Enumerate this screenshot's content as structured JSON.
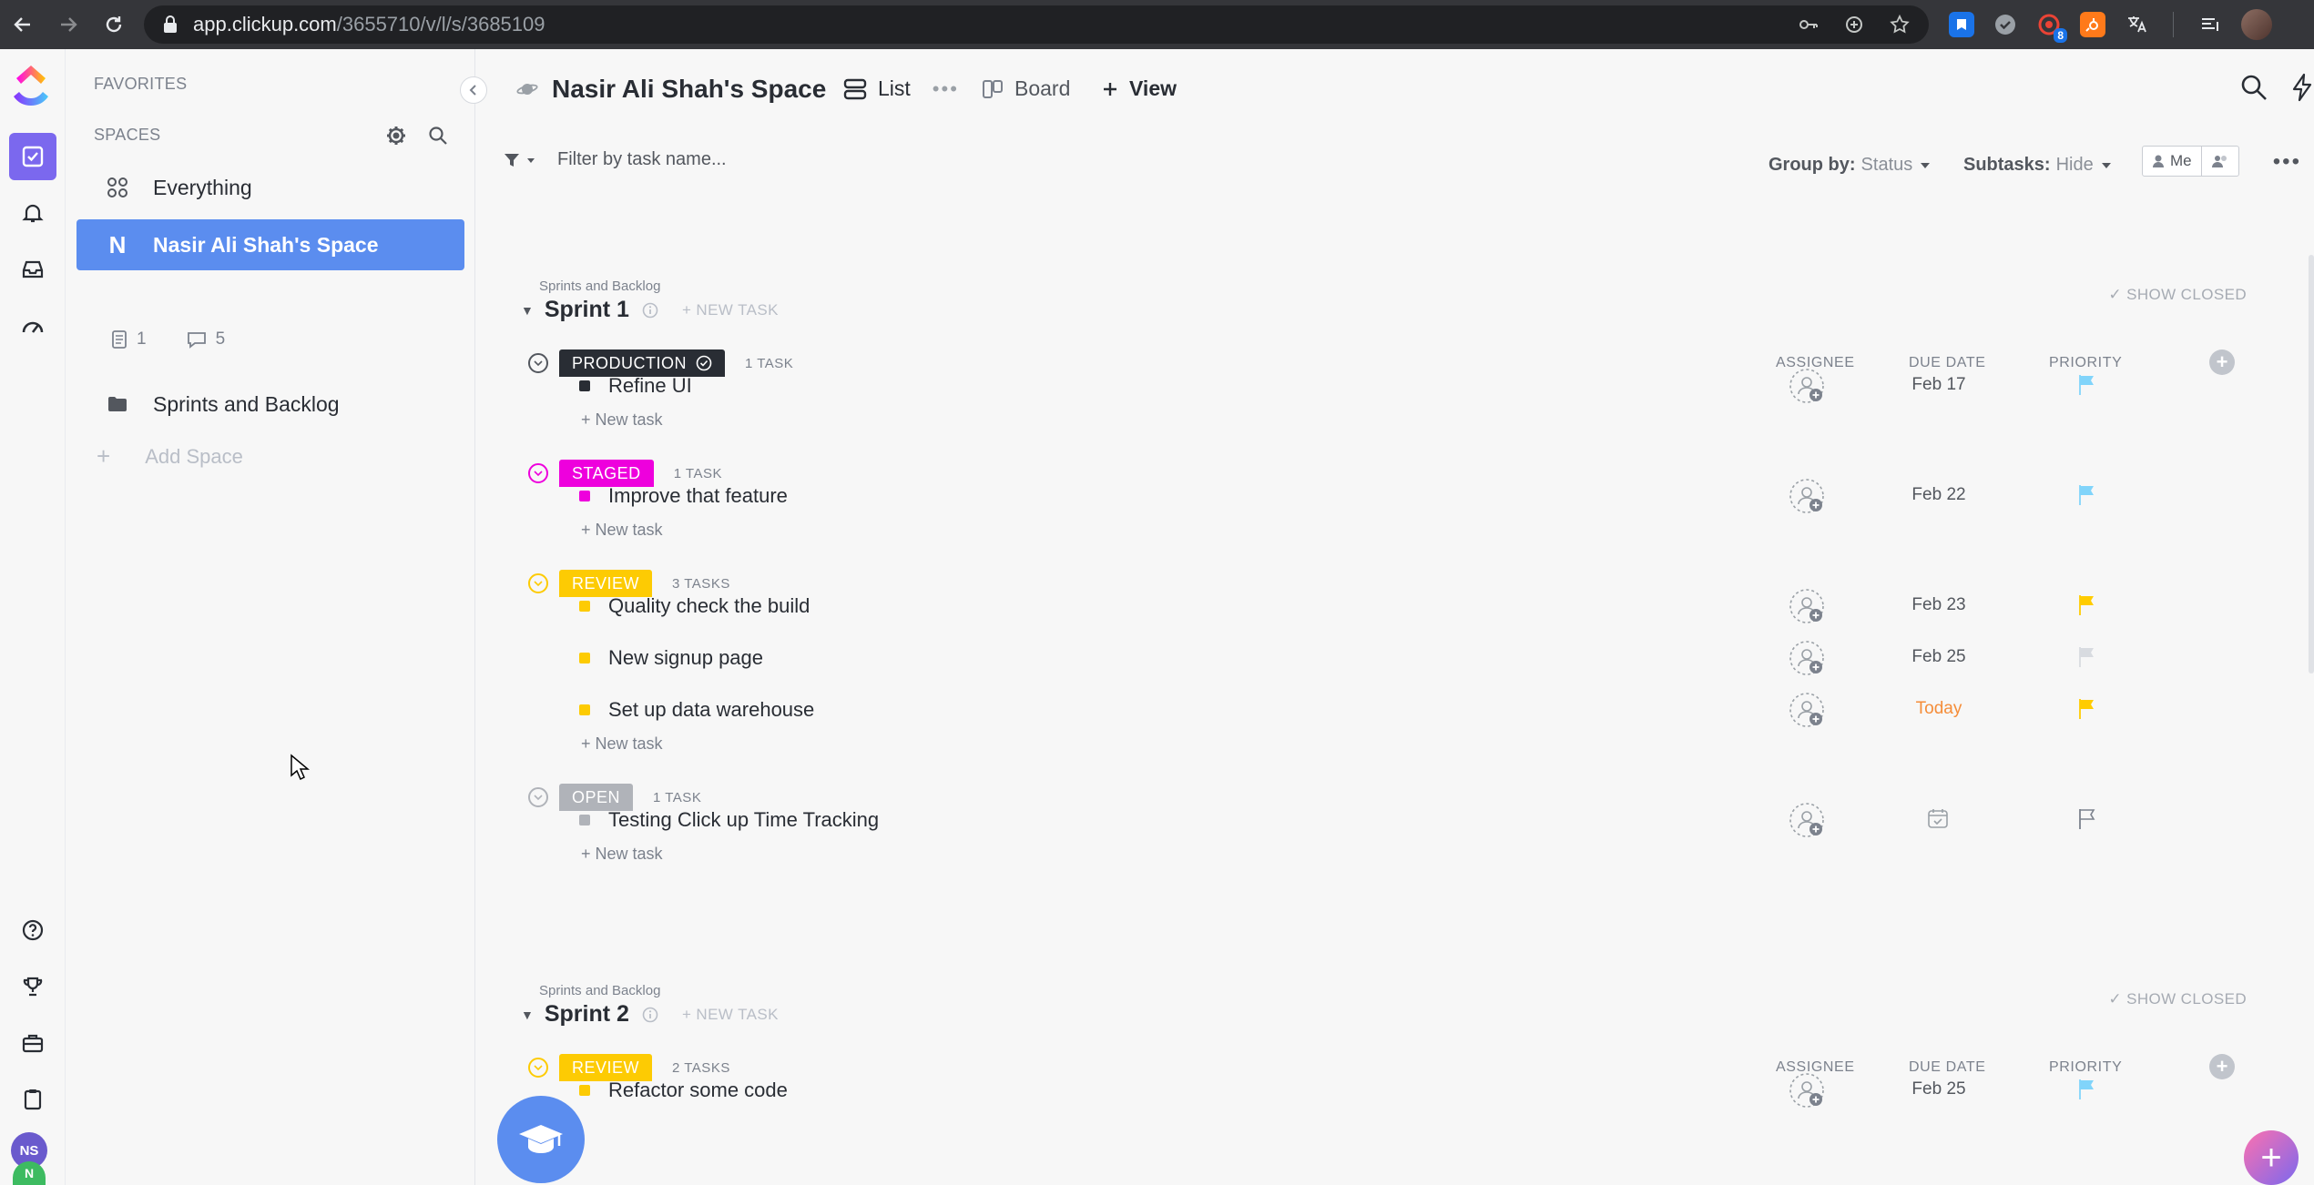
{
  "browser": {
    "url_host": "app.clickup.com",
    "url_path": "/3655710/v/l/s/3685109",
    "ext_badge": "8"
  },
  "rail": {
    "avatar_initials": "NS",
    "workspace_initial": "N"
  },
  "sidebar": {
    "favorites_label": "FAVORITES",
    "spaces_label": "SPACES",
    "items": [
      {
        "label": "Everything"
      },
      {
        "label": "Nasir Ali Shah's Space",
        "initial": "N"
      },
      {
        "label": "Sprints and Backlog"
      }
    ],
    "doc_count": "1",
    "comment_count": "5",
    "add_space_label": "Add Space"
  },
  "header": {
    "space_title": "Nasir Ali Shah's Space",
    "tabs": [
      {
        "label": "List"
      },
      {
        "label": "Board"
      },
      {
        "label": "View"
      }
    ]
  },
  "filterbar": {
    "filter_placeholder": "Filter by task name...",
    "group_by_label": "Group by:",
    "group_by_value": "Status",
    "subtasks_label": "Subtasks:",
    "subtasks_value": "Hide",
    "me_label": "Me"
  },
  "columns": {
    "assignee": "ASSIGNEE",
    "due_date": "DUE DATE",
    "priority": "PRIORITY"
  },
  "show_closed": "✓ SHOW CLOSED",
  "new_task_link": "+ New task",
  "sprint_new_task": "+ NEW TASK",
  "sprints": [
    {
      "crumb": "Sprints and Backlog",
      "title": "Sprint 1",
      "groups": [
        {
          "status": "PRODUCTION",
          "color": "#292d34",
          "count": "1 TASK",
          "tasks": [
            {
              "name": "Refine UI",
              "due": "Feb 17",
              "flag": "#81d4fa"
            }
          ]
        },
        {
          "status": "STAGED",
          "color": "#ee00dd",
          "count": "1 TASK",
          "tasks": [
            {
              "name": "Improve that feature",
              "due": "Feb 22",
              "flag": "#81d4fa"
            }
          ]
        },
        {
          "status": "REVIEW",
          "color": "#fdcb03",
          "count": "3 TASKS",
          "tasks": [
            {
              "name": "Quality check the build",
              "due": "Feb 23",
              "flag": "#ffcc00"
            },
            {
              "name": "New signup page",
              "due": "Feb 25",
              "flag": "#d8dbe0"
            },
            {
              "name": "Set up data warehouse",
              "due": "Today",
              "flag": "#ffcc00"
            }
          ]
        },
        {
          "status": "OPEN",
          "color": "#b0b3b9",
          "count": "1 TASK",
          "tasks": [
            {
              "name": "Testing Click up Time Tracking",
              "due": "",
              "flag": "none"
            }
          ]
        }
      ]
    },
    {
      "crumb": "Sprints and Backlog",
      "title": "Sprint 2",
      "groups": [
        {
          "status": "REVIEW",
          "color": "#fdcb03",
          "count": "2 TASKS",
          "tasks": [
            {
              "name": "Refactor some code",
              "due": "Feb 25",
              "flag": "#81d4fa"
            }
          ]
        }
      ]
    }
  ]
}
